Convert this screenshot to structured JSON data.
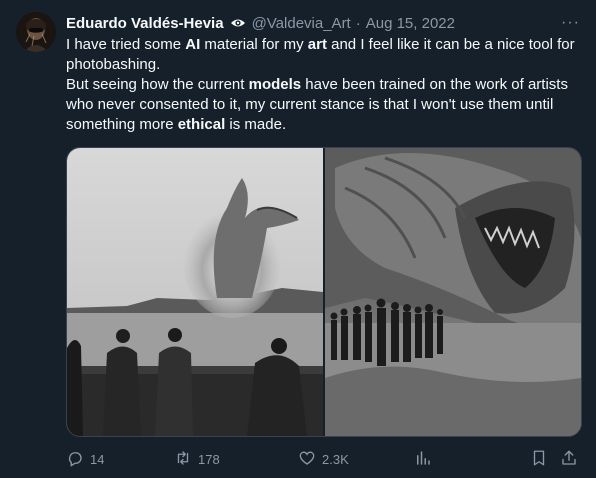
{
  "author": {
    "name": "Eduardo Valdés-Hevia",
    "handle": "@Valdevia_Art",
    "separator": "·",
    "date": "Aug 15, 2022"
  },
  "more_label": "···",
  "tweet": {
    "l1a": "I have tried some ",
    "l1b": "AI",
    "l1c": " material for my ",
    "l1d": "art",
    "l1e": " and I feel like it can be a nice tool for photobashing.",
    "l2a": "But seeing how the current ",
    "l2b": "models",
    "l2c": " have been trained on the work of artists who never consented to it, my current stance is that I won't use them until something more ",
    "l2d": "ethical",
    "l2e": " is made."
  },
  "actions": {
    "replies": "14",
    "retweets": "178",
    "likes": "2.3K"
  },
  "colors": {
    "background": "#15202b",
    "text": "#f7f9f9",
    "muted": "#8b98a5",
    "border": "#38444d"
  }
}
